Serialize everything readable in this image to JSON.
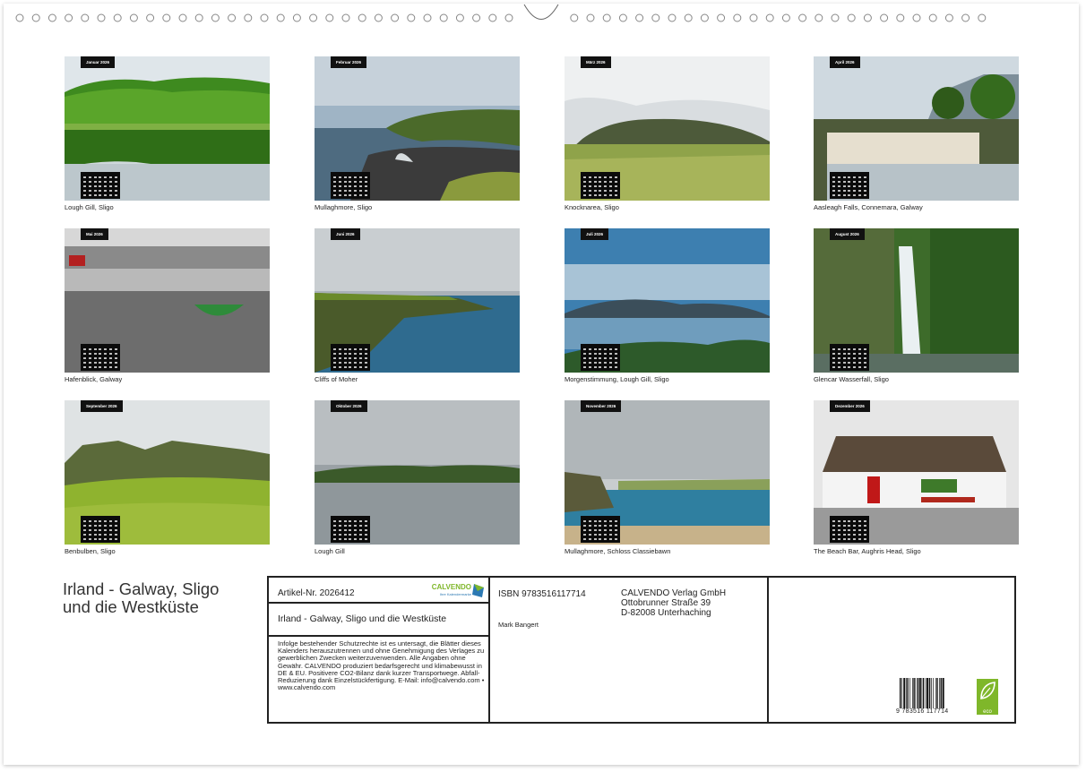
{
  "months": [
    {
      "label": "Januar 2026",
      "caption": "Lough Gill, Sligo",
      "scene": "lake"
    },
    {
      "label": "Februar 2026",
      "caption": "Mullaghmore, Sligo",
      "scene": "coast"
    },
    {
      "label": "März 2026",
      "caption": "Knocknarea, Sligo",
      "scene": "mountain"
    },
    {
      "label": "April 2026",
      "caption": "Aasleagh Falls, Connemara, Galway",
      "scene": "falls"
    },
    {
      "label": "Mai 2026",
      "caption": "Hafenblick, Galway",
      "scene": "harbour"
    },
    {
      "label": "Juni 2026",
      "caption": "Cliffs of Moher",
      "scene": "cliffs"
    },
    {
      "label": "Juli 2026",
      "caption": "Morgenstimmung, Lough Gill, Sligo",
      "scene": "morning"
    },
    {
      "label": "August 2026",
      "caption": "Glencar Wasserfall, Sligo",
      "scene": "waterfall"
    },
    {
      "label": "September 2026",
      "caption": "Benbulben, Sligo",
      "scene": "benbulben"
    },
    {
      "label": "Oktober 2026",
      "caption": "Lough Gill",
      "scene": "grey-lake"
    },
    {
      "label": "November 2026",
      "caption": "Mullaghmore, Schloss Classiebawn",
      "scene": "beach"
    },
    {
      "label": "Dezember 2026",
      "caption": "The Beach Bar, Aughris Head, Sligo",
      "scene": "pub"
    }
  ],
  "title": "Irland - Galway, Sligo und die Westküste",
  "info": {
    "article": "Artikel-Nr. 2026412",
    "brand": "CALVENDO",
    "brand_sub": "Ihre Kalendermarke",
    "title": "Irland - Galway, Sligo und die Westküste",
    "legal": "Infolge bestehender Schutzrechte ist es untersagt, die Blätter dieses Kalenders herauszutrennen und ohne Genehmigung des Verlages zu gewerblichen Zwecken weiterzuverwenden. Alle Angaben ohne Gewähr. CALVENDO produziert bedarfsgerecht und klimabewusst in DE & EU. Positivere CO2-Bilanz dank kurzer Transportwege. Abfall-Reduzierung dank Einzelstückfertigung. E-Mail: info@calvendo.com • www.calvendo.com",
    "isbn": "ISBN 9783516117714",
    "author": "Mark Bangert",
    "publisher_line1": "CALVENDO Verlag GmbH",
    "publisher_line2": "Ottobrunner Straße 39",
    "publisher_line3": "D-82008 Unterhaching",
    "barcode_digits": "9 783516 117714",
    "eco_label": "eco"
  },
  "colors": {
    "frame": "#222222",
    "brand_green": "#7fb72a",
    "brand_blue": "#2c79b3"
  }
}
